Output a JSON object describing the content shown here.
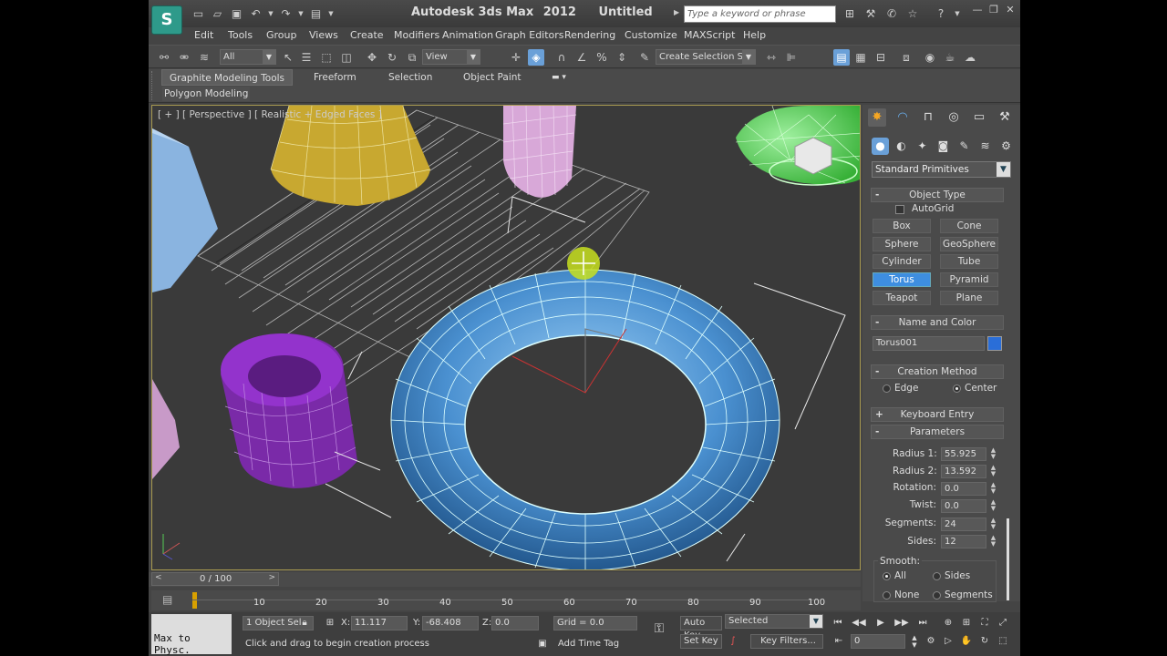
{
  "app": {
    "name": "Autodesk 3ds Max",
    "version": "2012",
    "document": "Untitled",
    "logo": "3ds-max-logo"
  },
  "search": {
    "placeholder": "Type a keyword or phrase"
  },
  "menu": [
    "Edit",
    "Tools",
    "Group",
    "Views",
    "Create",
    "Modifiers",
    "Animation",
    "Graph Editors",
    "Rendering",
    "Customize",
    "MAXScript",
    "Help"
  ],
  "toolbar": {
    "filter": "All",
    "ref_coord": "View",
    "selection_set": "Create Selection Se"
  },
  "ribbon": {
    "tabs": [
      "Graphite Modeling Tools",
      "Freeform",
      "Selection",
      "Object Paint"
    ],
    "subtab": "Polygon Modeling"
  },
  "viewport": {
    "label": "[ + ] [ Perspective ] [ Realistic + Edged Faces ]"
  },
  "panel": {
    "category": "Standard Primitives",
    "object_type": {
      "title": "Object Type",
      "sign": "-",
      "autogrid": "AutoGrid",
      "buttons": [
        "Box",
        "Cone",
        "Sphere",
        "GeoSphere",
        "Cylinder",
        "Tube",
        "Torus",
        "Pyramid",
        "Teapot",
        "Plane"
      ],
      "active": "Torus"
    },
    "name_color": {
      "title": "Name and Color",
      "sign": "-",
      "name": "Torus001",
      "color": "#2a6ed8"
    },
    "creation_method": {
      "title": "Creation Method",
      "sign": "-",
      "options": [
        "Edge",
        "Center"
      ],
      "selected": "Center"
    },
    "keyboard_entry": {
      "title": "Keyboard Entry",
      "sign": "+"
    },
    "parameters": {
      "title": "Parameters",
      "sign": "-",
      "radius1_label": "Radius 1:",
      "radius1": "55.925",
      "radius2_label": "Radius 2:",
      "radius2": "13.592",
      "rotation_label": "Rotation:",
      "rotation": "0.0",
      "twist_label": "Twist:",
      "twist": "0.0",
      "segments_label": "Segments:",
      "segments": "24",
      "sides_label": "Sides:",
      "sides": "12",
      "smooth_label": "Smooth:",
      "smooth_options": [
        "All",
        "Sides",
        "None",
        "Segments"
      ],
      "smooth_selected": "All"
    }
  },
  "timeline": {
    "frame": "0 / 100",
    "ticks": [
      "10",
      "20",
      "30",
      "40",
      "50",
      "60",
      "70",
      "80",
      "90",
      "100"
    ]
  },
  "status": {
    "maxscript": "Max to Physc.",
    "selection": "1 Object Sel",
    "prompt": "Click and drag to begin creation process",
    "x_label": "X:",
    "x": "11.117",
    "y_label": "Y:",
    "y": "-68.408",
    "z_label": "Z:",
    "z": "0.0",
    "grid": "Grid = 0.0",
    "add_time_tag": "Add Time Tag",
    "auto_key": "Auto Key",
    "set_key": "Set Key",
    "key_mode": "Selected",
    "key_filters": "Key Filters...",
    "current_frame": "0"
  },
  "colors": {
    "accent": "#3e8ee0",
    "viewport_bg": "#3a3a3a",
    "torus": "#4a90d0",
    "cone": "#c8a830",
    "tube": "#7a2aa8",
    "geosphere": "#55cc55",
    "box": "#8ab4e0",
    "cylinder": "#c89ac8"
  }
}
